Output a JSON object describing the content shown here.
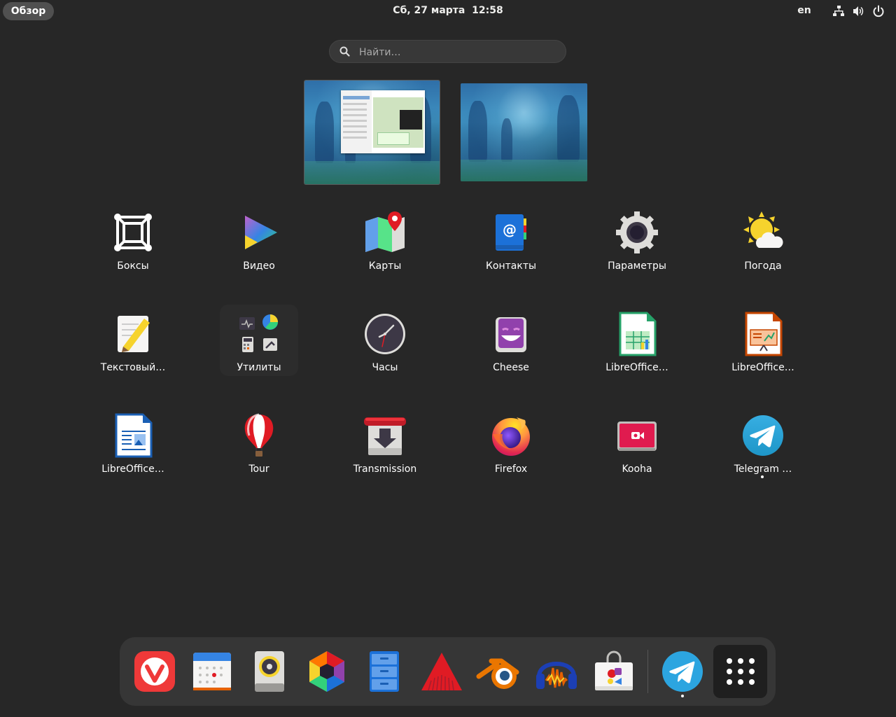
{
  "topbar": {
    "overview_label": "Обзор",
    "datetime": "Сб, 27 марта  12:58",
    "keyboard_layout": "en",
    "tray_icons": [
      "network-icon",
      "volume-icon",
      "power-icon"
    ]
  },
  "search": {
    "placeholder": "Найти…"
  },
  "workspaces": [
    {
      "name": "workspace-1",
      "has_windows": true
    },
    {
      "name": "workspace-2",
      "has_windows": false
    }
  ],
  "apps": [
    {
      "label": "Боксы",
      "icon": "boxes-icon"
    },
    {
      "label": "Видео",
      "icon": "video-icon"
    },
    {
      "label": "Карты",
      "icon": "maps-icon"
    },
    {
      "label": "Контакты",
      "icon": "contacts-icon"
    },
    {
      "label": "Параметры",
      "icon": "settings-gear-icon"
    },
    {
      "label": "Погода",
      "icon": "weather-icon"
    },
    {
      "label": "Текстовый…",
      "icon": "text-editor-icon"
    },
    {
      "label": "Утилиты",
      "icon": "utilities-folder-icon"
    },
    {
      "label": "Часы",
      "icon": "clock-icon"
    },
    {
      "label": "Cheese",
      "icon": "cheese-icon"
    },
    {
      "label": "LibreOffice…",
      "icon": "libreoffice-calc-icon"
    },
    {
      "label": "LibreOffice…",
      "icon": "libreoffice-impress-icon"
    },
    {
      "label": "LibreOffice…",
      "icon": "libreoffice-writer-icon"
    },
    {
      "label": "Tour",
      "icon": "tour-balloon-icon"
    },
    {
      "label": "Transmission",
      "icon": "transmission-icon"
    },
    {
      "label": "Firefox",
      "icon": "firefox-icon"
    },
    {
      "label": "Kooha",
      "icon": "kooha-icon"
    },
    {
      "label": "Telegram …",
      "icon": "telegram-icon",
      "running": true
    }
  ],
  "dock": {
    "items": [
      {
        "icon": "vivaldi-icon"
      },
      {
        "icon": "calendar-icon"
      },
      {
        "icon": "rhythmbox-icon"
      },
      {
        "icon": "hexagon-app-icon"
      },
      {
        "icon": "files-cabinet-icon"
      },
      {
        "icon": "red-triangle-app-icon"
      },
      {
        "icon": "blender-icon"
      },
      {
        "icon": "audacity-icon"
      },
      {
        "icon": "software-store-icon"
      },
      {
        "icon": "telegram-icon",
        "running": true
      }
    ],
    "show_apps_icon": "show-apps-grid-icon"
  }
}
